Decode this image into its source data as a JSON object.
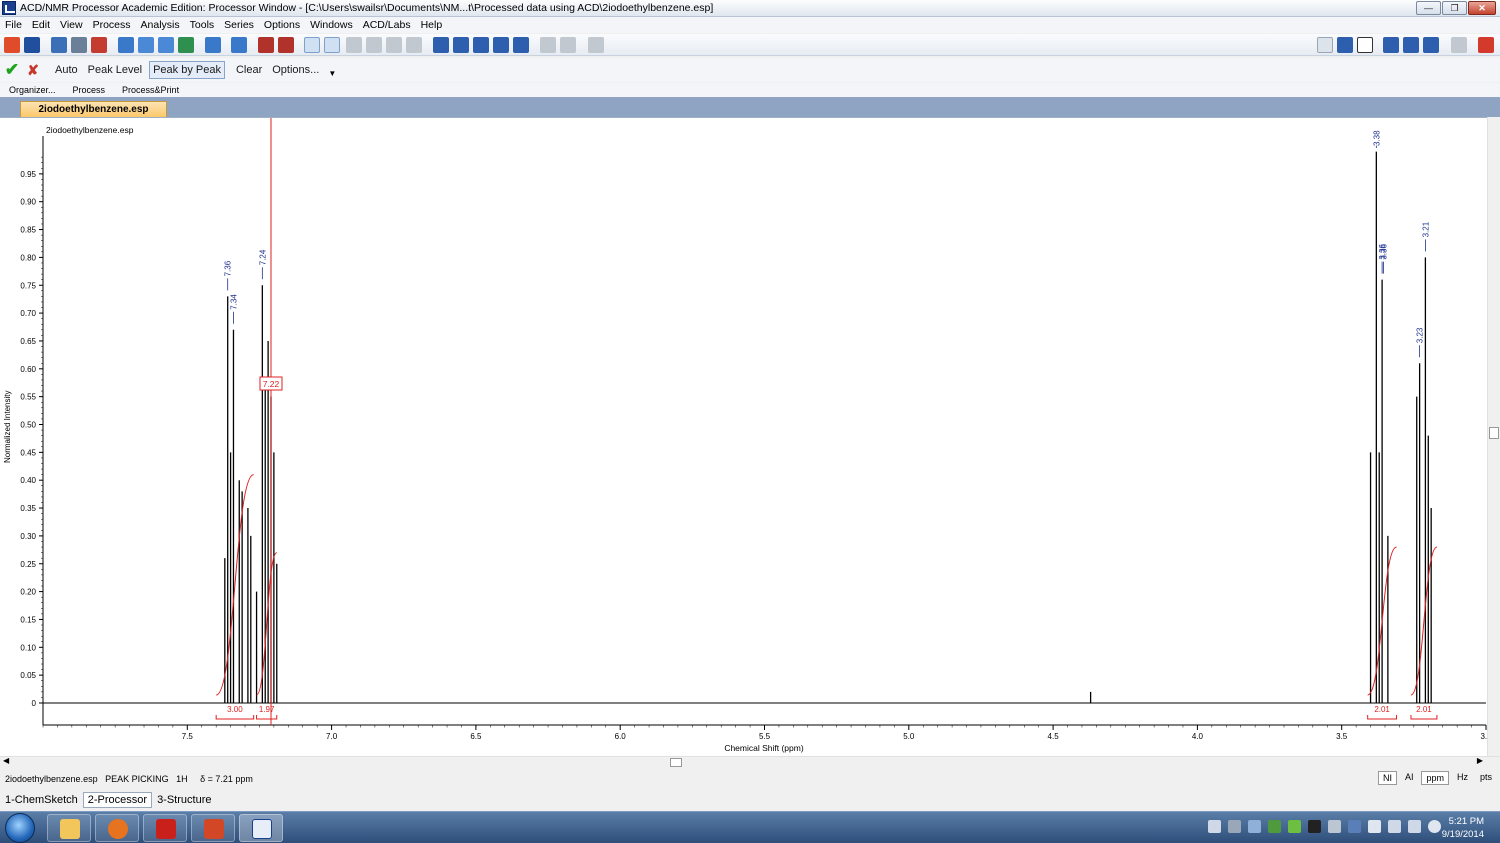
{
  "window": {
    "title": "ACD/NMR Processor Academic Edition: Processor Window - [C:\\Users\\swailsr\\Documents\\NM...t\\Processed data using ACD\\2iodoethylbenzene.esp]",
    "controls": [
      "minimize",
      "restore",
      "close"
    ]
  },
  "menu": [
    "File",
    "Edit",
    "View",
    "Process",
    "Analysis",
    "Tools",
    "Series",
    "Options",
    "Windows",
    "ACD/Labs",
    "Help"
  ],
  "toolbar2": {
    "buttons": [
      "Auto",
      "Peak Level",
      "Peak by Peak",
      "Clear",
      "Options..."
    ],
    "pressed": "Peak by Peak"
  },
  "panel_tabs": [
    "Organizer...",
    "Process",
    "Process&Print"
  ],
  "document_tab": "2iodoethylbenzene.esp",
  "spectrum_label": "2iodoethylbenzene.esp",
  "chart_data": {
    "type": "line",
    "xlabel": "Chemical Shift (ppm)",
    "ylabel": "Normalized Intensity",
    "xlim": [
      8.0,
      3.0
    ],
    "ylim": [
      0,
      1.0
    ],
    "x_reversed": true,
    "x_ticks": [
      "7.5",
      "7.0",
      "6.5",
      "6.0",
      "5.5",
      "5.0",
      "4.5",
      "4.0",
      "3.5",
      "3.0"
    ],
    "y_ticks": [
      "0",
      "0.05",
      "0.10",
      "0.15",
      "0.20",
      "0.25",
      "0.30",
      "0.35",
      "0.40",
      "0.45",
      "0.50",
      "0.55",
      "0.60",
      "0.65",
      "0.70",
      "0.75",
      "0.80",
      "0.85",
      "0.90",
      "0.95"
    ],
    "peaks": [
      {
        "x": 7.37,
        "y": 0.26
      },
      {
        "x": 7.36,
        "y": 0.73
      },
      {
        "x": 7.35,
        "y": 0.45
      },
      {
        "x": 7.34,
        "y": 0.67
      },
      {
        "x": 7.32,
        "y": 0.4
      },
      {
        "x": 7.31,
        "y": 0.38
      },
      {
        "x": 7.29,
        "y": 0.35
      },
      {
        "x": 7.28,
        "y": 0.3
      },
      {
        "x": 7.26,
        "y": 0.2
      },
      {
        "x": 7.24,
        "y": 0.75
      },
      {
        "x": 7.23,
        "y": 0.57
      },
      {
        "x": 7.22,
        "y": 0.65
      },
      {
        "x": 7.21,
        "y": 0.55
      },
      {
        "x": 7.2,
        "y": 0.45
      },
      {
        "x": 7.19,
        "y": 0.25
      },
      {
        "x": 4.37,
        "y": 0.02
      },
      {
        "x": 3.4,
        "y": 0.45
      },
      {
        "x": 3.38,
        "y": 0.99
      },
      {
        "x": 3.37,
        "y": 0.45
      },
      {
        "x": 3.36,
        "y": 0.76
      },
      {
        "x": 3.34,
        "y": 0.3
      },
      {
        "x": 3.24,
        "y": 0.55
      },
      {
        "x": 3.23,
        "y": 0.61
      },
      {
        "x": 3.21,
        "y": 0.8
      },
      {
        "x": 3.2,
        "y": 0.48
      },
      {
        "x": 3.19,
        "y": 0.35
      }
    ],
    "peak_labels": [
      {
        "x": 7.36,
        "text": "7.36"
      },
      {
        "x": 7.34,
        "text": "7.34"
      },
      {
        "x": 7.24,
        "text": "7.24"
      },
      {
        "x": 3.38,
        "text": "3.38"
      },
      {
        "x": 3.36,
        "text": "3.36"
      },
      {
        "x": 3.355,
        "text": "3.36"
      },
      {
        "x": 3.23,
        "text": "3.23"
      },
      {
        "x": 3.21,
        "text": "3.21"
      }
    ],
    "cursor": {
      "x": 7.21,
      "label": "7.22"
    },
    "integrals": [
      {
        "from": 7.4,
        "to": 7.27,
        "value": "3.00",
        "height": 0.41
      },
      {
        "from": 7.26,
        "to": 7.19,
        "value": "1.97",
        "height": 0.27
      },
      {
        "from": 3.41,
        "to": 3.31,
        "value": "2.01",
        "height": 0.28
      },
      {
        "from": 3.26,
        "to": 3.17,
        "value": "2.01",
        "height": 0.28
      }
    ]
  },
  "status": {
    "text": "2iodoethylbenzene.esp   PEAK PICKING   1H     δ = 7.21 ppm",
    "buttons": [
      "NI",
      "AI",
      "ppm",
      "Hz",
      "pts"
    ],
    "active": "ppm"
  },
  "mode_tabs": [
    "1-ChemSketch",
    "2-Processor",
    "3-Structure"
  ],
  "active_mode": "2-Processor",
  "clock": {
    "time": "5:21 PM",
    "date": "9/19/2014"
  }
}
